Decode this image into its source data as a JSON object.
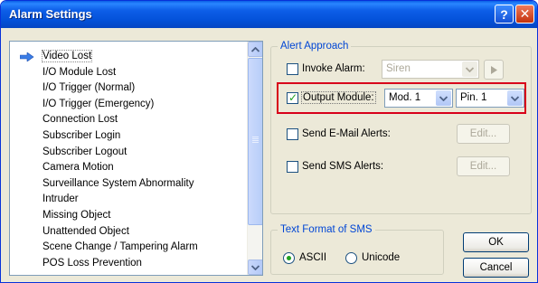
{
  "window": {
    "title": "Alarm Settings",
    "help_label": "?",
    "close_label": "✕"
  },
  "event_list": {
    "items": [
      {
        "label": "Video Lost",
        "selected": true
      },
      {
        "label": "I/O Module Lost"
      },
      {
        "label": "I/O Trigger (Normal)"
      },
      {
        "label": "I/O Trigger (Emergency)"
      },
      {
        "label": "Connection Lost"
      },
      {
        "label": "Subscriber Login"
      },
      {
        "label": "Subscriber Logout"
      },
      {
        "label": "Camera Motion"
      },
      {
        "label": "Surveillance System Abnormality"
      },
      {
        "label": "Intruder"
      },
      {
        "label": "Missing Object"
      },
      {
        "label": "Unattended Object"
      },
      {
        "label": "Scene Change / Tampering Alarm"
      },
      {
        "label": "POS Loss Prevention"
      }
    ]
  },
  "alert_approach": {
    "legend": "Alert Approach",
    "invoke_alarm": {
      "label": "Invoke Alarm:",
      "checked": false,
      "value": "Siren"
    },
    "output_module": {
      "label": "Output Module:",
      "checked": true,
      "module": "Mod. 1",
      "pin": "Pin. 1"
    },
    "send_email": {
      "label": "Send E-Mail Alerts:",
      "checked": false,
      "button": "Edit..."
    },
    "send_sms": {
      "label": "Send SMS Alerts:",
      "checked": false,
      "button": "Edit..."
    }
  },
  "sms_format": {
    "legend": "Text Format of SMS",
    "options": [
      {
        "label": "ASCII",
        "selected": true
      },
      {
        "label": "Unicode",
        "selected": false
      }
    ]
  },
  "buttons": {
    "ok": "OK",
    "cancel": "Cancel"
  },
  "colors": {
    "titlebar": "#0452da",
    "highlight": "#d8001a",
    "legend": "#0046d5"
  }
}
